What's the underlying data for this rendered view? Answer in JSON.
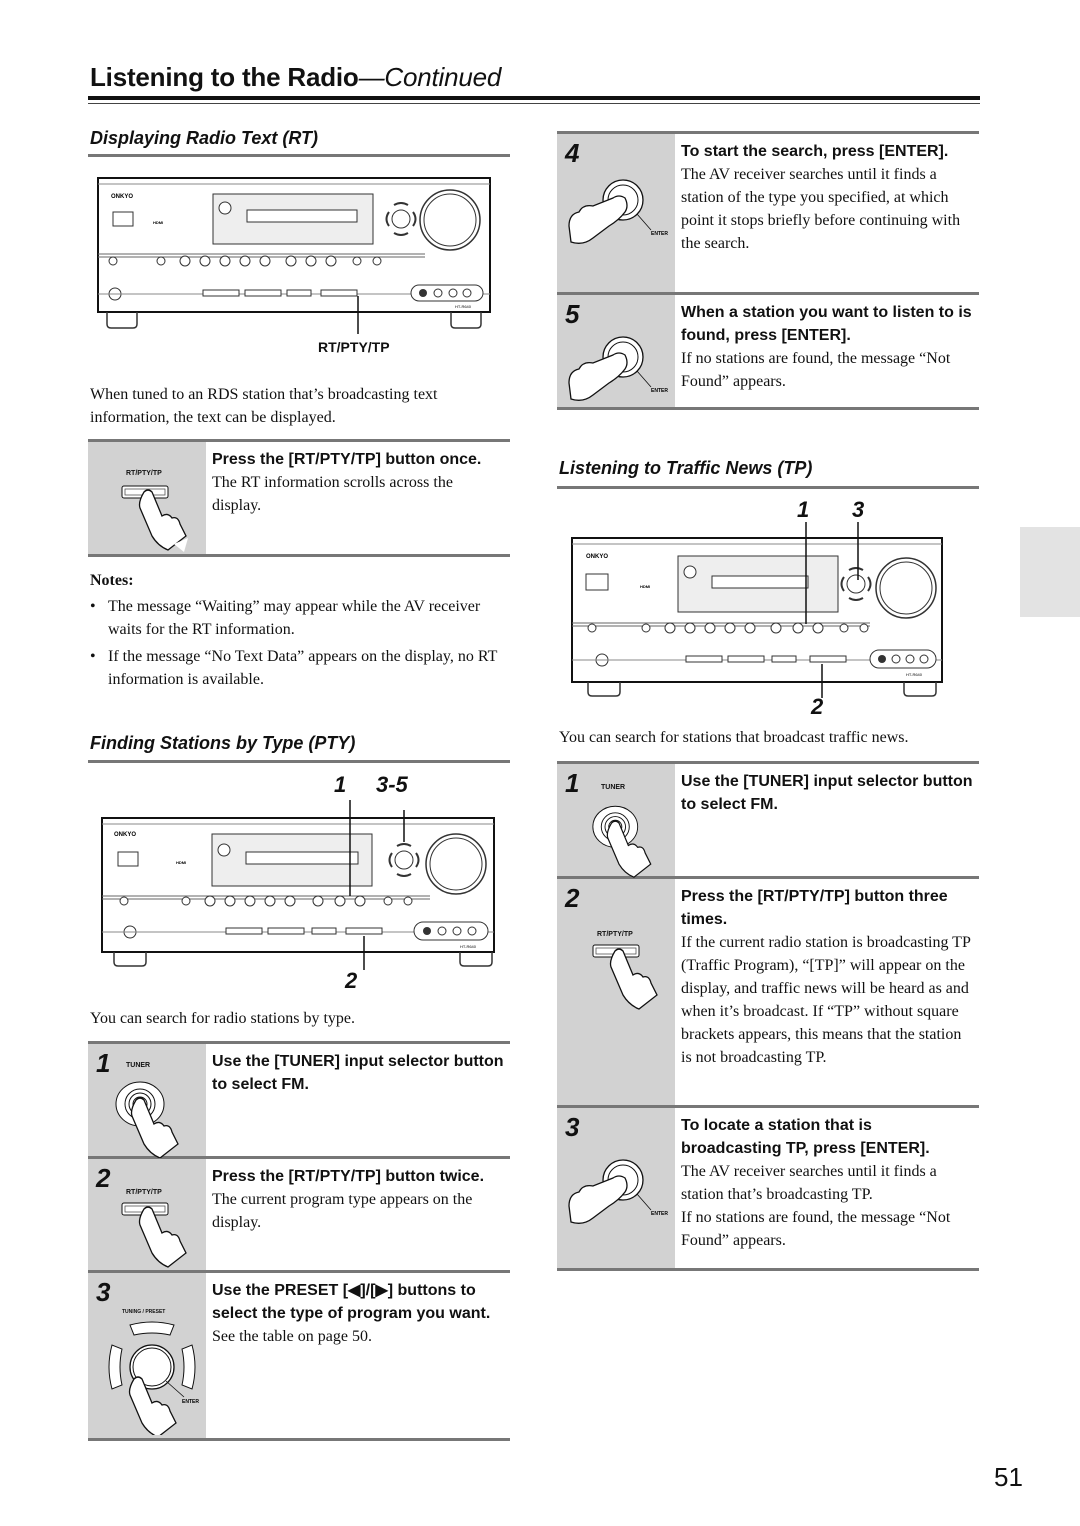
{
  "header": {
    "title": "Listening to the Radio",
    "title_suffix": "—Continued"
  },
  "rt_section": {
    "heading": "Displaying Radio Text (RT)",
    "diagram_callout": "RT/PTY/TP",
    "intro": "When tuned to an RDS station that’s broadcasting text information, the text can be displayed.",
    "step": {
      "icon_label": "RT/PTY/TP",
      "title": "Press the [RT/PTY/TP] button once.",
      "desc": "The RT information scrolls across the display."
    },
    "notes_heading": "Notes:",
    "notes": [
      "The message “Waiting” may appear while the AV receiver waits for the RT information.",
      "If the message “No Text Data” appears on the display, no RT information is available."
    ]
  },
  "pty_section": {
    "heading": "Finding Stations by Type (PTY)",
    "callouts": {
      "a": "1",
      "b": "3-5",
      "c": "2"
    },
    "intro": "You can search for radio stations by type.",
    "steps": [
      {
        "num": "1",
        "icon_label": "TUNER",
        "title": "Use the [TUNER] input selector button to select FM.",
        "desc": ""
      },
      {
        "num": "2",
        "icon_label": "RT/PTY/TP",
        "title": "Press the [RT/PTY/TP] button twice.",
        "desc": "The current program type appears on the display."
      },
      {
        "num": "3",
        "icon_label": "TUNING / PRESET",
        "icon_sublabel": "ENTER",
        "title": "Use the PRESET [◀]/[▶] buttons to select the type of program you want.",
        "desc": "See the table on page 50."
      },
      {
        "num": "4",
        "icon_label": "ENTER",
        "title": "To start the search, press [ENTER].",
        "desc": "The AV receiver searches until it finds a station of the type you specified, at which point it stops briefly before continuing with the search."
      },
      {
        "num": "5",
        "icon_label": "ENTER",
        "title": "When a station you want to listen to is found, press [ENTER].",
        "desc": "If no stations are found, the message “Not Found” appears."
      }
    ]
  },
  "tp_section": {
    "heading": "Listening to Traffic News (TP)",
    "callouts": {
      "a": "1",
      "b": "3",
      "c": "2"
    },
    "intro": "You can search for stations that broadcast traffic news.",
    "steps": [
      {
        "num": "1",
        "icon_label": "TUNER",
        "title": "Use the [TUNER] input selector button to select FM.",
        "desc": ""
      },
      {
        "num": "2",
        "icon_label": "RT/PTY/TP",
        "title": "Press the [RT/PTY/TP] button three times.",
        "desc": "If the current radio station is broadcasting TP (Traffic Program), “[TP]” will appear on the display, and traffic news will be heard as and when it’s broadcast. If “TP” without square brackets appears, this means that the station is not broadcasting TP."
      },
      {
        "num": "3",
        "icon_label": "ENTER",
        "title": "To locate a station that is broadcasting TP, press [ENTER].",
        "desc": "The AV receiver searches until it finds a station that’s broadcasting TP.",
        "desc2": "If no stations are found, the message “Not Found” appears."
      }
    ]
  },
  "receiver": {
    "brand": "ONKYO",
    "model": "HT-R640",
    "hdmi": "HDMI"
  },
  "footer": {
    "page_number": "51"
  }
}
